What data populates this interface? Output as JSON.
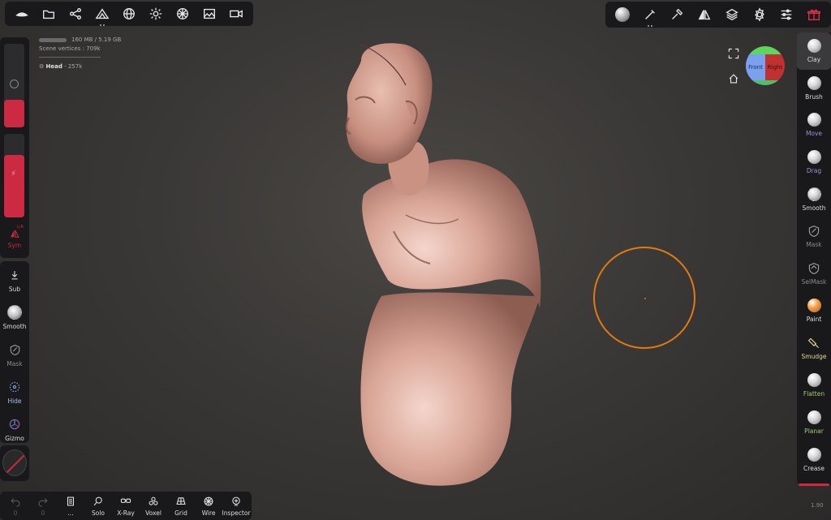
{
  "stats": {
    "memory": "160 MB / 5.19 GB",
    "scene_vertices": "Scene vertices : 709k",
    "object_name": "Head",
    "object_vertices": "- 257k"
  },
  "top_left_toolbar": [
    "logo-icon",
    "folder-icon",
    "scene-graph-icon",
    "topology-icon",
    "sphere-icon",
    "light-icon",
    "material-icon",
    "image-icon",
    "video-icon"
  ],
  "top_right_toolbar": [
    "matcap-icon",
    "stroke-icon",
    "picker-icon",
    "symmetry-icon",
    "layers-icon",
    "settings-icon",
    "sliders-icon",
    "gift-icon"
  ],
  "left_tools": {
    "sym": "Sym",
    "sym_badge": "L/R",
    "sub": "Sub",
    "smooth": "Smooth",
    "mask": "Mask",
    "hide": "Hide",
    "gizmo": "Gizmo"
  },
  "undo_count": "0",
  "redo_count": "0",
  "bottom_tools": {
    "more": "...",
    "solo": "Solo",
    "xray": "X-Ray",
    "voxel": "Voxel",
    "grid": "Grid",
    "wire": "Wire",
    "inspector": "Inspector"
  },
  "right_tools": [
    {
      "label": "Clay",
      "color": "#e6e6e6"
    },
    {
      "label": "Brush",
      "color": "#e6e6e6"
    },
    {
      "label": "Move",
      "color": "#a48ed6"
    },
    {
      "label": "Drag",
      "color": "#a48ed6"
    },
    {
      "label": "Smooth",
      "color": "#e6e6e6"
    },
    {
      "label": "Mask",
      "color": "#8b8b8b"
    },
    {
      "label": "SelMask",
      "color": "#8b8b8b"
    },
    {
      "label": "Paint",
      "color": "#e6e6e6"
    },
    {
      "label": "Smudge",
      "color": "#e8d69a"
    },
    {
      "label": "Flatten",
      "color": "#9ecf77"
    },
    {
      "label": "Planar",
      "color": "#9ecf77"
    },
    {
      "label": "Crease",
      "color": "#e6e6e6"
    }
  ],
  "view_cube": {
    "front": "Front",
    "right": "Right"
  },
  "version": "1.90",
  "colors": {
    "accent_red": "#cc2a43",
    "brush_ring": "#e07a12",
    "model": "#d9a596"
  }
}
